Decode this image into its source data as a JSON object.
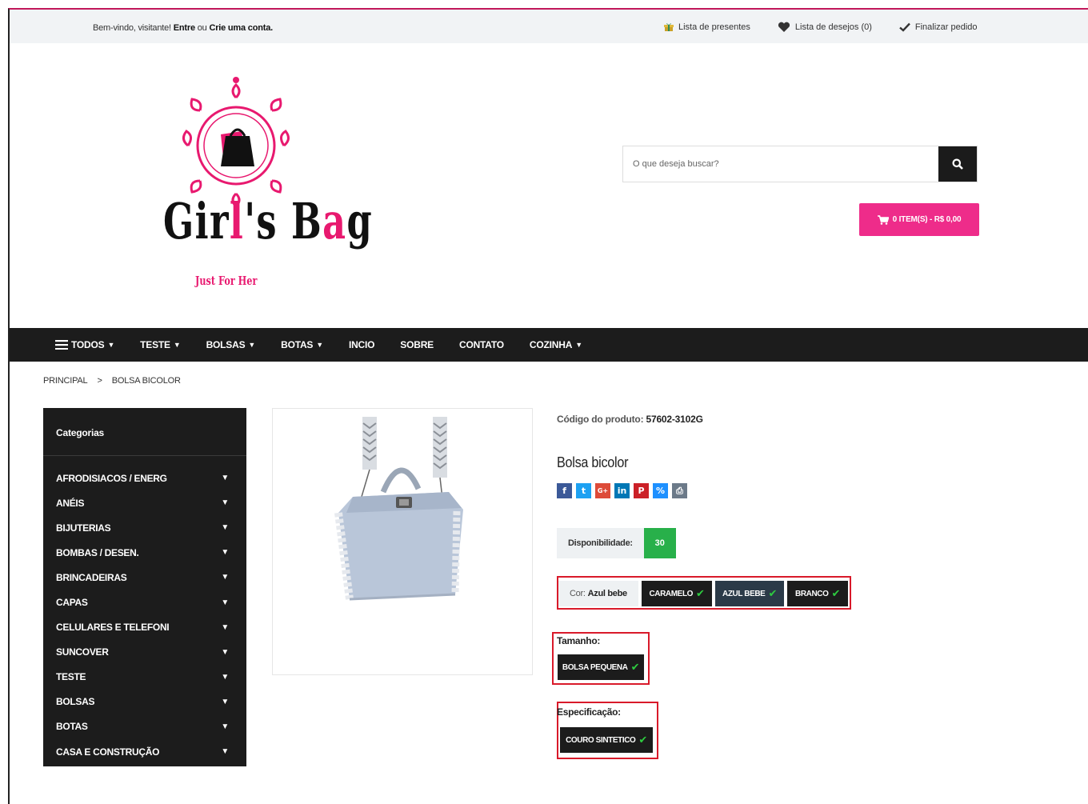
{
  "topbar": {
    "welcome_prefix": "Bem-vindo, visitante!",
    "login": "Entre",
    "or": "ou",
    "register": "Crie uma conta.",
    "gift_list": "Lista de presentes",
    "wishlist": "Lista de desejos (0)",
    "checkout": "Finalizar pedido"
  },
  "logo": {
    "brand_a": "Gir",
    "brand_b": "l",
    "brand_c": "'s B",
    "brand_d": "a",
    "brand_e": "g",
    "tagline": "Just For Her"
  },
  "search": {
    "placeholder": "O que deseja buscar?"
  },
  "cart": {
    "label": "0 ITEM(S) - R$ 0,00"
  },
  "nav": {
    "items": [
      {
        "label": "TODOS",
        "dropdown": true
      },
      {
        "label": "TESTE",
        "dropdown": true
      },
      {
        "label": "BOLSAS",
        "dropdown": true
      },
      {
        "label": "BOTAS",
        "dropdown": true
      },
      {
        "label": "INCIO",
        "dropdown": false
      },
      {
        "label": "SOBRE",
        "dropdown": false
      },
      {
        "label": "CONTATO",
        "dropdown": false
      },
      {
        "label": "COZINHA",
        "dropdown": true
      }
    ]
  },
  "breadcrumb": {
    "home": "PRINCIPAL",
    "sep": ">",
    "current": "BOLSA BICOLOR"
  },
  "sidebar": {
    "title": "Categorias",
    "items": [
      "AFRODISIACOS / ENERG",
      "ANÉIS",
      "BIJUTERIAS",
      "BOMBAS / DESEN.",
      "BRINCADEIRAS",
      "CAPAS",
      "CELULARES E TELEFONI",
      "SUNCOVER",
      "TESTE",
      "BOLSAS",
      "BOTAS",
      "CASA E CONSTRUÇÃO"
    ]
  },
  "product": {
    "code_label": "Código do produto:",
    "code": "57602-3102G",
    "title": "Bolsa bicolor",
    "availability_label": "Disponibilidade:",
    "availability_value": "30",
    "color_label": "Cor:",
    "color_value": "Azul bebe",
    "colors": [
      "CARAMELO",
      "AZUL BEBE",
      "BRANCO"
    ],
    "size_label": "Tamanho:",
    "size_option": "BOLSA PEQUENA",
    "spec_label": "Especificação:",
    "spec_option": "COURO SINTETICO"
  },
  "social": [
    "f",
    "t",
    "G+",
    "in",
    "P",
    "%",
    "⎙"
  ],
  "colors": {
    "accent_pink": "#ee2c8a",
    "dark": "#1c1c1c",
    "available_green": "#28b04a",
    "highlight_red": "#d91a2a"
  }
}
